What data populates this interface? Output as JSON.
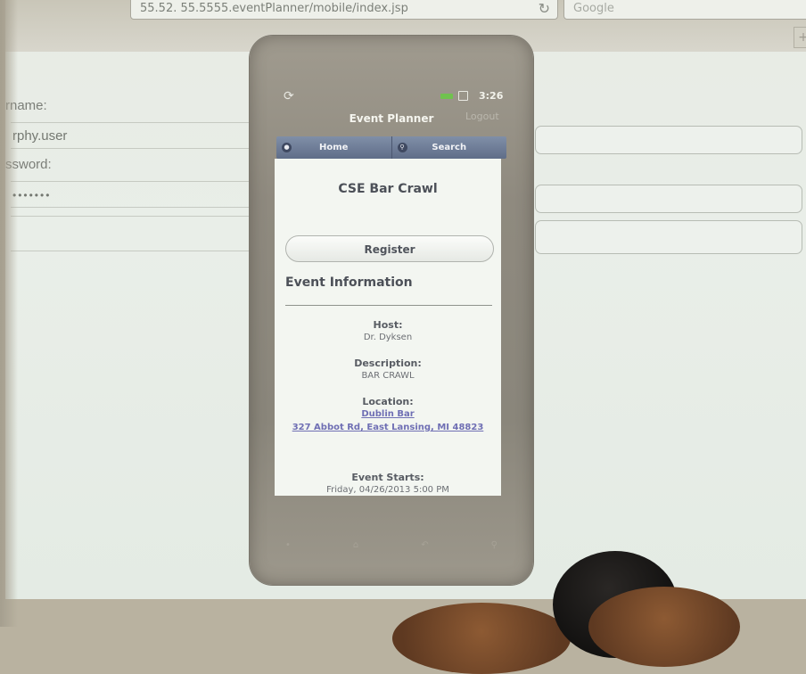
{
  "browser": {
    "url": "55.52. 55.5555.eventPlanner/mobile/index.jsp",
    "search_placeholder": "Google",
    "reload_icon": "reload-icon",
    "new_tab": "+"
  },
  "login_form": {
    "username_label": "rname:",
    "username_value": "rphy.user",
    "password_label": "ssword:",
    "password_value": "•••••••"
  },
  "phone": {
    "status_bar": {
      "sync_icon": "sync-icon",
      "time": "3:26"
    },
    "app_title": "Event Planner",
    "logout_label": "Logout",
    "nav": {
      "home_label": "Home",
      "search_label": "Search",
      "home_icon": "home-icon",
      "search_icon": "search-icon"
    },
    "event": {
      "title": "CSE Bar Crawl",
      "register_label": "Register",
      "info_heading": "Event Information",
      "host_label": "Host:",
      "host_value": "Dr. Dyksen",
      "description_label": "Description:",
      "description_value": "BAR CRAWL",
      "location_label": "Location:",
      "location_name": "Dublin Bar",
      "location_address": "327 Abbot Rd, East Lansing, MI 48823",
      "starts_label": "Event Starts:",
      "starts_value": "Friday, 04/26/2013 5:00 PM"
    }
  }
}
